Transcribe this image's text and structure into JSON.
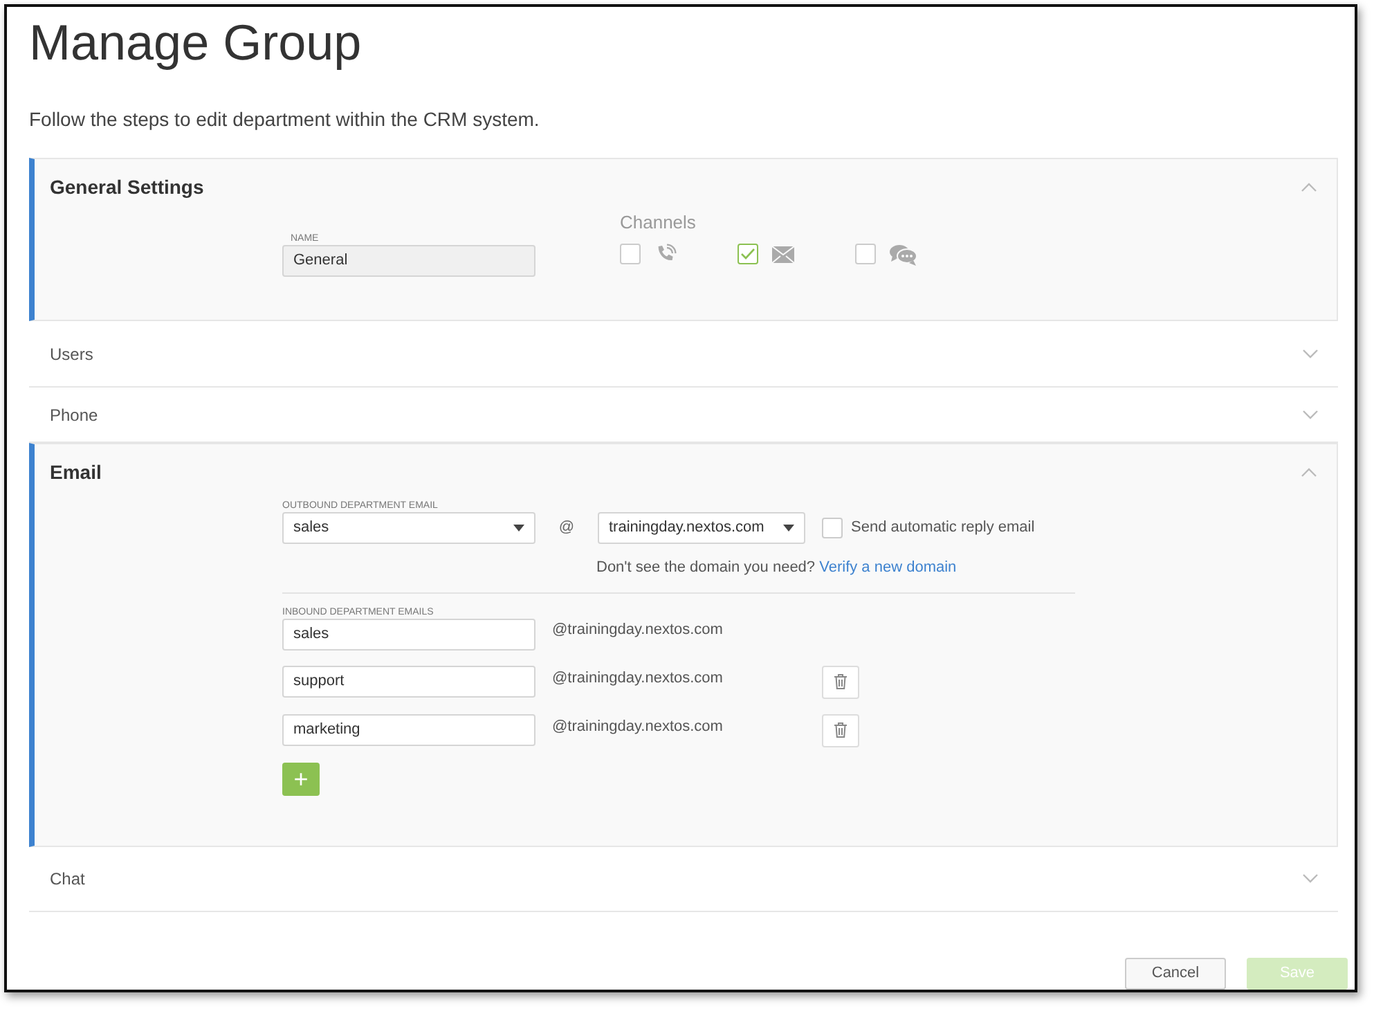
{
  "title": "Manage Group",
  "subtitle": "Follow the steps to edit department within the CRM system.",
  "sections": [
    {
      "kind": "general",
      "title": "General Settings",
      "expanded": true,
      "name_field": {
        "label": "NAME",
        "value": "General"
      },
      "channels": {
        "label": "Channels",
        "items": [
          {
            "kind": "phone",
            "checked": false
          },
          {
            "kind": "email",
            "checked": true
          },
          {
            "kind": "chat",
            "checked": false
          }
        ]
      }
    },
    {
      "title": "Users",
      "expanded": false
    },
    {
      "title": "Phone",
      "expanded": false
    },
    {
      "kind": "email",
      "title": "Email",
      "expanded": true,
      "outbound": {
        "label": "OUTBOUND DEPARTMENT EMAIL",
        "local": "sales",
        "at": "@",
        "domain": "trainingday.nextos.com",
        "auto_reply": {
          "label": "Send automatic reply email",
          "checked": false
        },
        "hint": "Don't see the domain you need?",
        "link": "Verify a new domain"
      },
      "inbound": {
        "label": "INBOUND DEPARTMENT EMAILS",
        "rows": [
          {
            "value": "sales",
            "domain": "@trainingday.nextos.com",
            "removable": false
          },
          {
            "value": "support",
            "domain": "@trainingday.nextos.com",
            "removable": true
          },
          {
            "value": "marketing",
            "domain": "@trainingday.nextos.com",
            "removable": true
          }
        ],
        "add": "+"
      }
    },
    {
      "title": "Chat",
      "expanded": false
    }
  ],
  "footer": [
    {
      "label": "Cancel",
      "kind": "secondary",
      "disabled": false
    },
    {
      "label": "Save",
      "kind": "primary",
      "disabled": true
    }
  ]
}
